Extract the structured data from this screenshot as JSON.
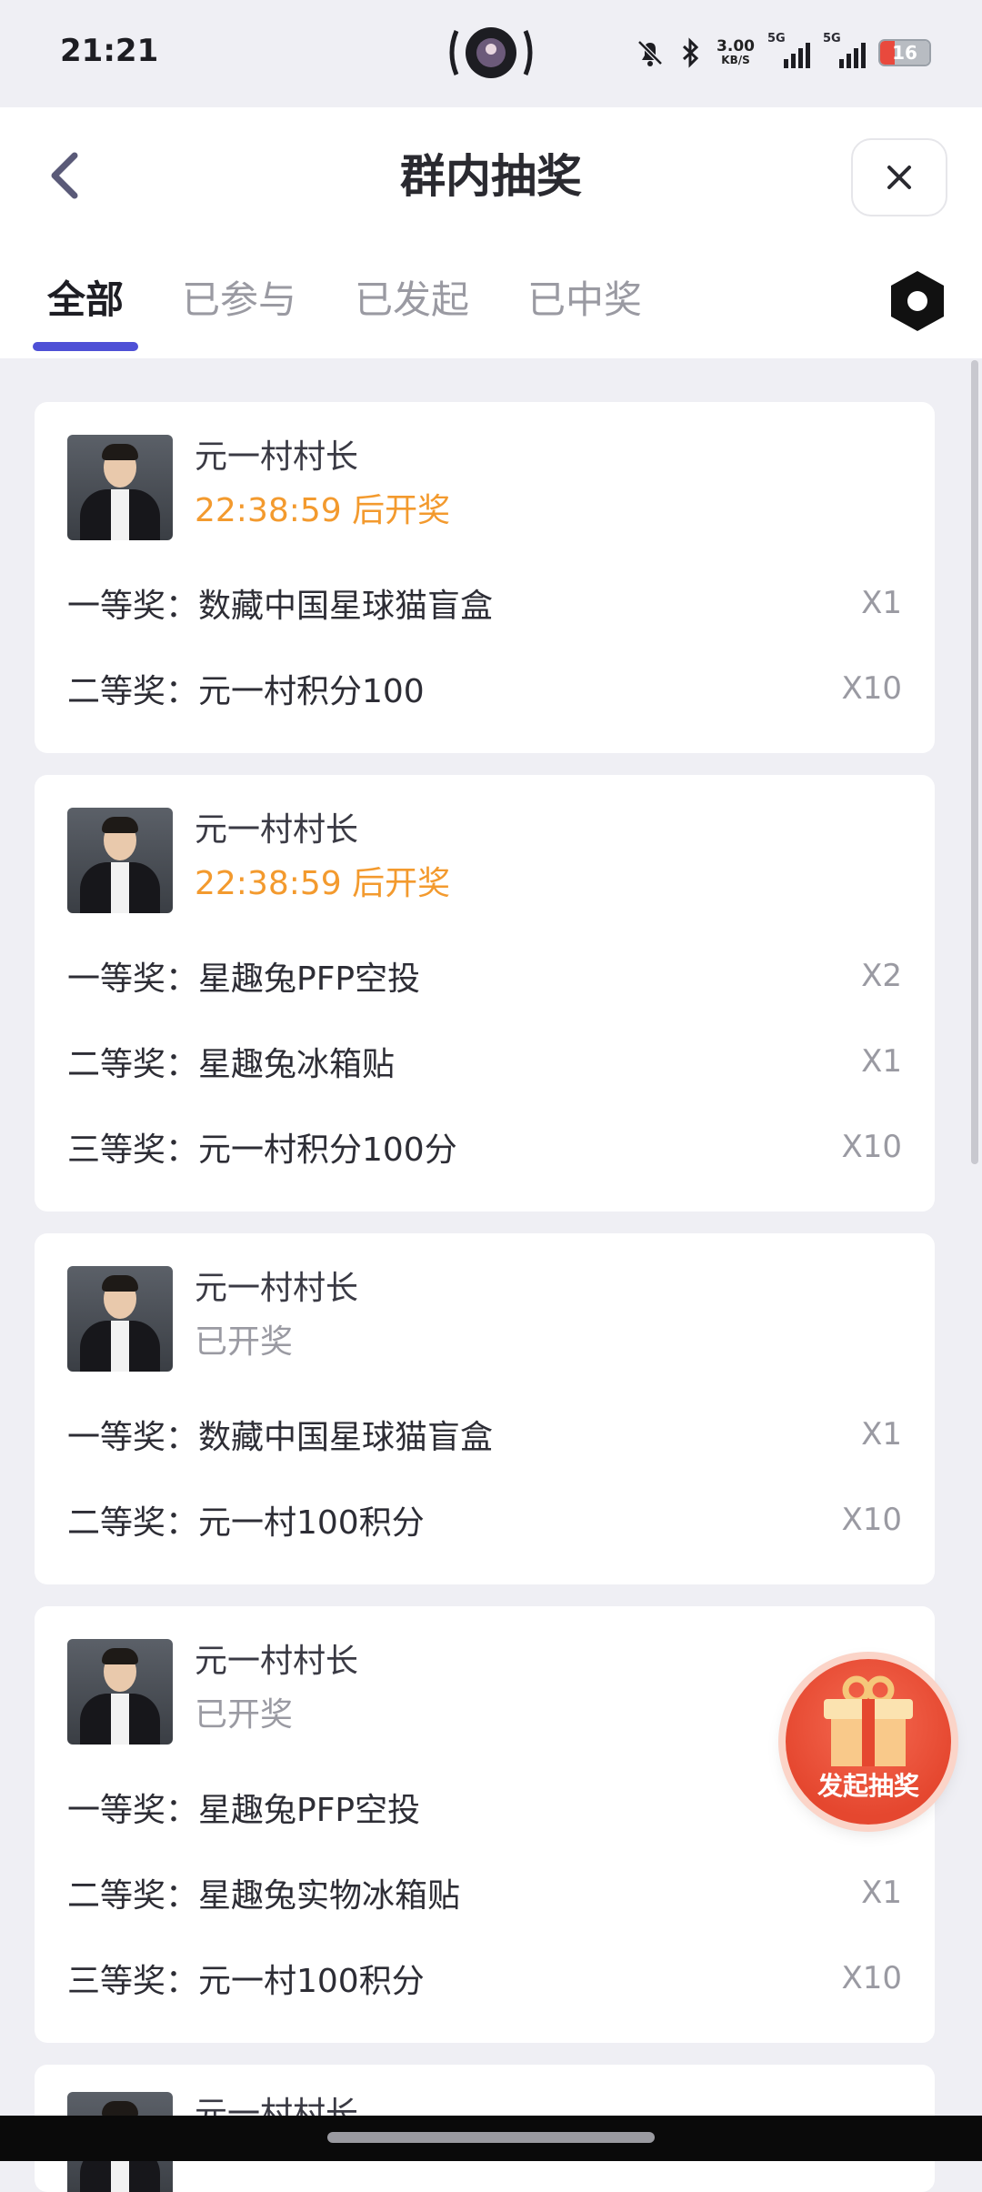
{
  "status_bar": {
    "time": "21:21",
    "net_speed_value": "3.00",
    "net_speed_unit": "KB/S",
    "signal1": "5G",
    "signal2": "5G",
    "battery": "16"
  },
  "header": {
    "title": "群内抽奖",
    "back_icon": "chevron-left-icon",
    "close_icon": "close-icon"
  },
  "tabs": [
    {
      "label": "全部",
      "active": true
    },
    {
      "label": "已参与",
      "active": false
    },
    {
      "label": "已发起",
      "active": false
    },
    {
      "label": "已中奖",
      "active": false
    }
  ],
  "cards": [
    {
      "host": "元一村村长",
      "status": "22:38:59 后开奖",
      "prizes": [
        {
          "label": "一等奖：数藏中国星球猫盲盒",
          "qty": "X1"
        },
        {
          "label": "二等奖：元一村积分100",
          "qty": "X10"
        }
      ]
    },
    {
      "host": "元一村村长",
      "status": "22:38:59 后开奖",
      "prizes": [
        {
          "label": "一等奖：星趣兔PFP空投",
          "qty": "X2"
        },
        {
          "label": "二等奖：星趣兔冰箱贴",
          "qty": "X1"
        },
        {
          "label": "三等奖：元一村积分100分",
          "qty": "X10"
        }
      ]
    },
    {
      "host": "元一村村长",
      "status": "已开奖",
      "prizes": [
        {
          "label": "一等奖：数藏中国星球猫盲盒",
          "qty": "X1"
        },
        {
          "label": "二等奖：元一村100积分",
          "qty": "X10"
        }
      ]
    },
    {
      "host": "元一村村长",
      "status": "已开奖",
      "prizes": [
        {
          "label": "一等奖：星趣兔PFP空投",
          "qty": ""
        },
        {
          "label": "二等奖：星趣兔实物冰箱贴",
          "qty": "X1"
        },
        {
          "label": "三等奖：元一村100积分",
          "qty": "X10"
        }
      ]
    },
    {
      "host": "元一村村长"
    }
  ],
  "fab": {
    "label": "发起抽奖",
    "icon": "gift-icon"
  },
  "colors": {
    "accent": "#4e50d6",
    "pending": "#f39a2e",
    "fab": "#e5472f"
  }
}
